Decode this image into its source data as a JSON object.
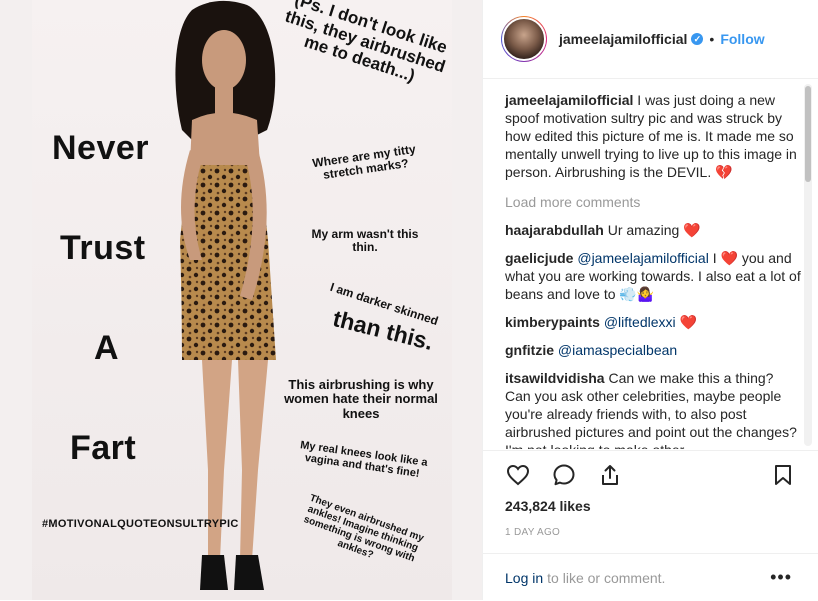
{
  "photo": {
    "caption_big": [
      "Never",
      "Trust",
      "A",
      "Fart"
    ],
    "note_top": "(Ps. I don't look like this, they airbrushed me to death...)",
    "note_stretch": "Where are my titty stretch marks?",
    "note_arm": "My arm wasn't this thin.",
    "note_darker_a": "I am darker skinned",
    "note_darker_b": "than this.",
    "note_knees": "This airbrushing is why women hate their normal knees",
    "note_real_knees": "My real knees look like a vagina and that's fine!",
    "note_ankles": "They even airbrushed my ankles! Imagine thinking something is wrong with ankles?",
    "hashtag": "#MOTIVONALQUOTEONSULTRYPIC"
  },
  "header": {
    "username": "jameelajamilofficial",
    "verified_icon": "verified-badge-icon",
    "separator": "•",
    "follow_label": "Follow"
  },
  "caption": {
    "user": "jameelajamilofficial",
    "text": "I was just doing a new spoof motivation sultry pic and was struck by how edited this picture of me is. It made me so mentally unwell trying to live up to this image in person. Airbrushing is the DEVIL.",
    "emoji": "💔"
  },
  "load_more": "Load more comments",
  "comments": [
    {
      "user": "haajarabdullah",
      "text": "Ur amazing",
      "emoji": "❤️"
    },
    {
      "user": "gaelicjude",
      "mention": "@jameelajamilofficial",
      "text_a": "I",
      "emoji": "❤️",
      "text_b": "you and what you are working towards. I also eat a lot of beans and love to",
      "emoji2": "💨🤷‍♀️"
    },
    {
      "user": "kimberypaints",
      "mention": "@liftedlexxi",
      "emoji": "❤️"
    },
    {
      "user": "gnfitzie",
      "mention": "@iamaspecialbean"
    },
    {
      "user": "itsawildvidisha",
      "text": "Can we make this a thing? Can you ask other celebrities, maybe people you're already friends with, to also post airbrushed pictures and point out the changes? I'm not looking to make other"
    }
  ],
  "likes": "243,824 likes",
  "time_ago": "1 DAY AGO",
  "login": {
    "link": "Log in",
    "rest": "to like or comment.",
    "more": "•••"
  },
  "colors": {
    "accent": "#3897f0",
    "text": "#262626",
    "muted": "#999999",
    "heart": "#ed1c24"
  }
}
